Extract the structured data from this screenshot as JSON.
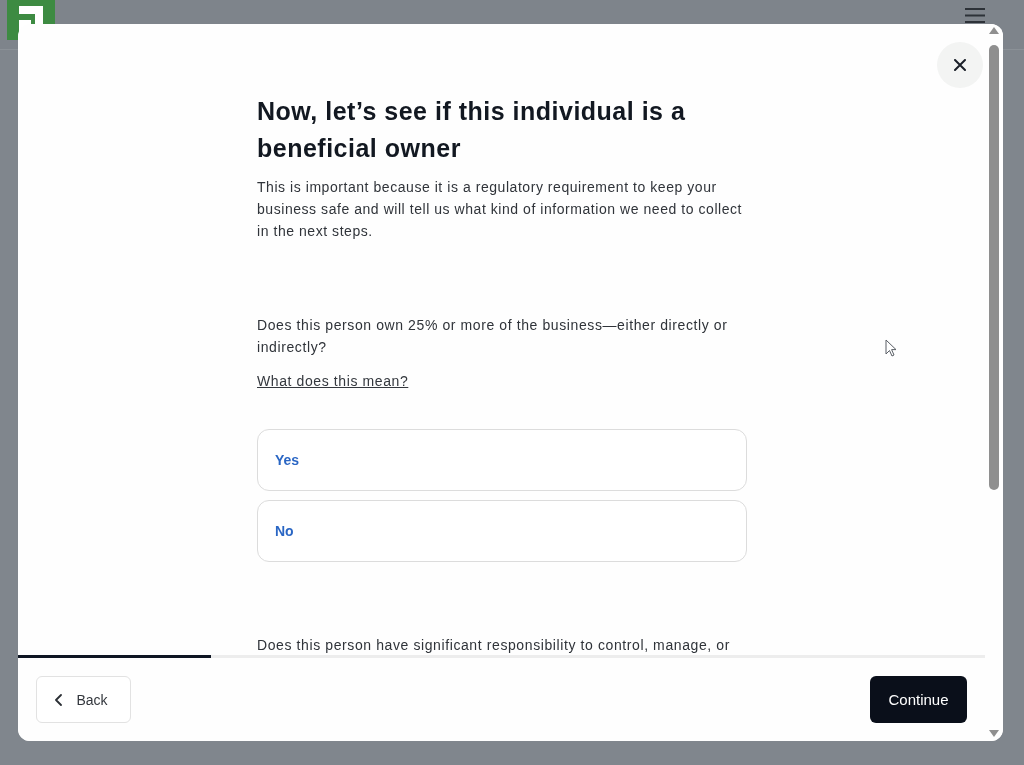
{
  "dialog": {
    "heading": "Now, let’s see if this individual is a beneficial owner",
    "intro": "This is important because it is a regulatory requirement to keep your business safe and will tell us what kind of information we need to collect in the next steps.",
    "questions": [
      {
        "text": "Does this person own 25% or more of the business—either directly or indirectly?",
        "help_link": "What does this mean?",
        "options": [
          {
            "label": "Yes",
            "selected": false
          },
          {
            "label": "No",
            "selected": false
          }
        ]
      },
      {
        "text": "Does this person have significant responsibility to control, manage, or"
      }
    ],
    "progress": {
      "level": 0.2
    },
    "footer": {
      "back": "Back",
      "continue": "Continue"
    }
  }
}
